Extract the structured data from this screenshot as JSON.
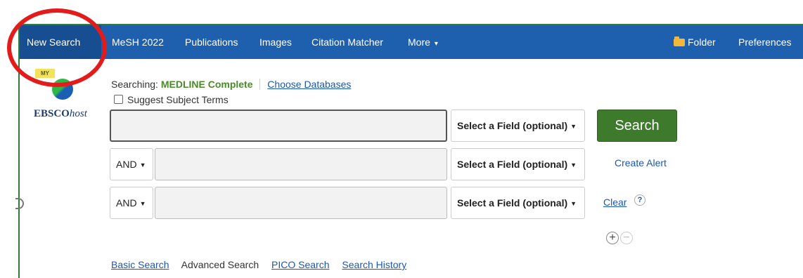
{
  "nav": {
    "items": [
      {
        "label": "New Search"
      },
      {
        "label": "MeSH 2022"
      },
      {
        "label": "Publications"
      },
      {
        "label": "Images"
      },
      {
        "label": "Citation Matcher"
      },
      {
        "label": "More"
      }
    ],
    "folder": "Folder",
    "preferences": "Preferences"
  },
  "logo": {
    "badge": "MY",
    "brand_main": "EBSCO",
    "brand_italic": "host"
  },
  "searching": {
    "prefix": "Searching:",
    "database": "MEDLINE Complete",
    "choose": "Choose Databases"
  },
  "suggest_label": "Suggest Subject Terms",
  "rows": [
    {
      "operator": "",
      "value": "",
      "field": "Select a Field (optional)"
    },
    {
      "operator": "AND",
      "value": "",
      "field": "Select a Field (optional)"
    },
    {
      "operator": "AND",
      "value": "",
      "field": "Select a Field (optional)"
    }
  ],
  "actions": {
    "search": "Search",
    "create_alert": "Create Alert",
    "clear": "Clear",
    "help": "?",
    "add": "+",
    "remove": "−"
  },
  "bottom_links": {
    "basic": "Basic Search",
    "advanced": "Advanced Search",
    "pico": "PICO Search",
    "history": "Search History"
  },
  "colors": {
    "nav_bg": "#1e5fae",
    "search_button": "#3e7a2c",
    "annotation_ring": "#e41b1b",
    "database_name": "#4a8a2b"
  },
  "icons": [
    "folder-icon",
    "help-icon",
    "add-row-icon",
    "remove-row-icon",
    "chevron-down-icon"
  ]
}
